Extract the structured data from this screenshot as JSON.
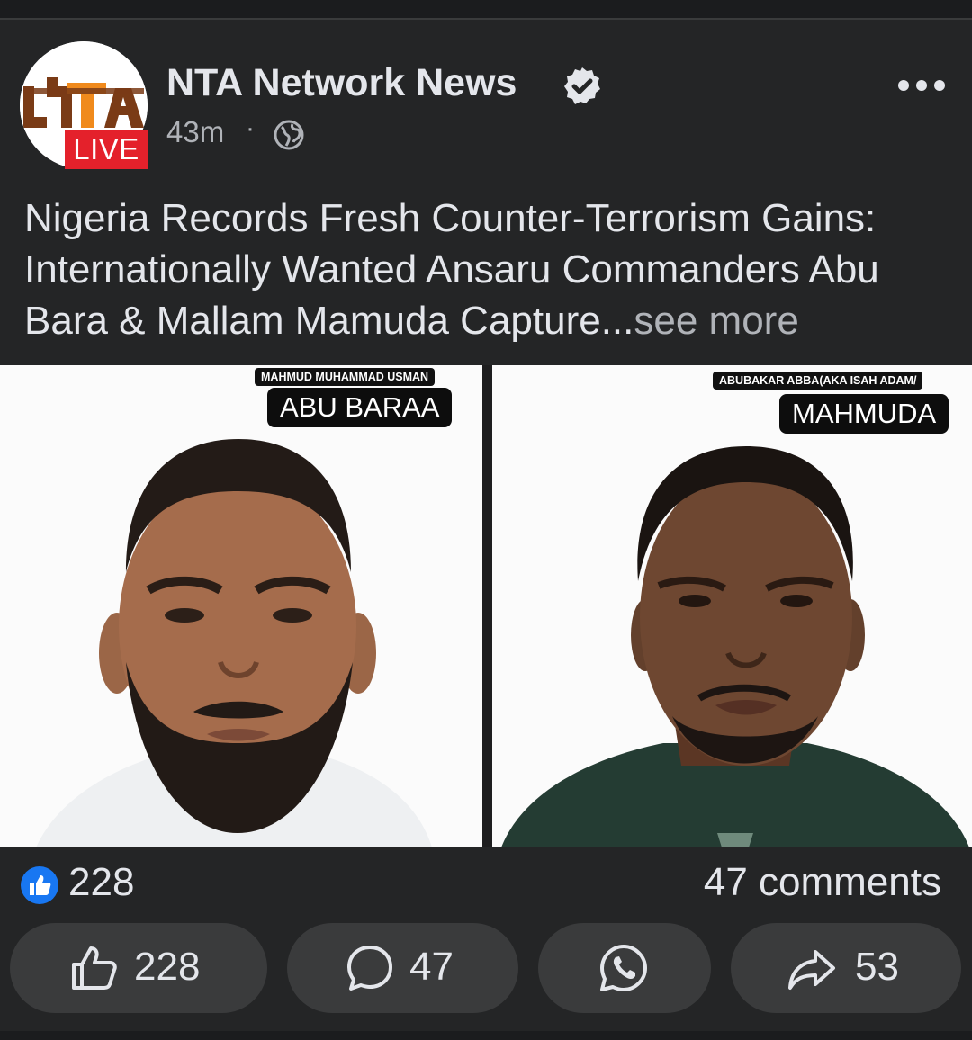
{
  "post": {
    "page_name": "NTA Network News",
    "live_badge": "LIVE",
    "avatar_logo_text": "NTA",
    "time": "43m",
    "separator": "·",
    "text": "Nigeria Records Fresh Counter-Terrorism Gains: Internationally Wanted Ansaru Commanders Abu Bara & Mallam Mamuda Capture...",
    "see_more": "see more"
  },
  "images": [
    {
      "small_label": "MAHMUD MUHAMMAD USMAN",
      "big_label": "ABU BARAA"
    },
    {
      "small_label": "ABUBAKAR ABBA(AKA ISAH ADAM/",
      "big_label": "MAHMUDA"
    }
  ],
  "stats": {
    "likes": "228",
    "comments": "47 comments"
  },
  "actions": {
    "like": "228",
    "comment": "47",
    "share": "53"
  },
  "colors": {
    "background": "#242526",
    "button": "#3a3b3c",
    "live_red": "#e4212b",
    "like_blue": "#1877f2",
    "text": "#e4e6eb",
    "muted": "#b0b3b8"
  },
  "icons": [
    "verified-icon",
    "globe-icon",
    "more-icon",
    "like-icon",
    "comment-icon",
    "whatsapp-icon",
    "share-icon"
  ]
}
